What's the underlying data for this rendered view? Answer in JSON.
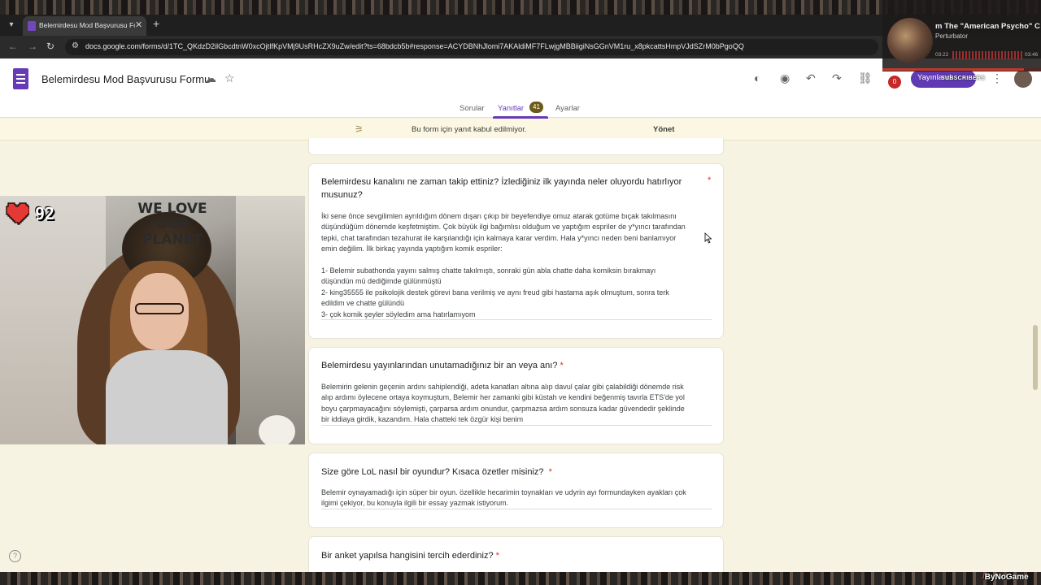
{
  "browser": {
    "tab_title": "Belemirdesu Mod Başvurusu Fo",
    "url": "docs.google.com/forms/d/1TC_QKdzD2ilGbcdtnW0xcOjtIfKpVMj9UsRHcZX9uZw/edit?ts=68bdcb5b#response=ACYDBNhJlomi7AKAldiMF7FLwjgMBBiigiNsGGnVM1ru_x8pkcattsHmpVJdSZrM0bPgoQQ"
  },
  "header": {
    "title": "Belemirdesu Mod Başvurusu Formu",
    "publish_label": "Yayınlandı",
    "notification_count": "0"
  },
  "tabs": {
    "questions": "Sorular",
    "responses": "Yanıtlar",
    "responses_count": "41",
    "settings": "Ayarlar"
  },
  "banner": {
    "text": "Bu form için yanıt kabul edilmiyor.",
    "action": "Yönet"
  },
  "questions": [
    {
      "title": "Belemirdesu kanalını ne zaman takip ettiniz? İzlediğiniz ilk yayında neler oluyordu hatırlıyor\nmusunuz?",
      "required_mark": "*",
      "answer": "İki sene önce sevgilimlen ayrıldığım dönem dışarı çıkıp bir beyefendiye omuz atarak gotüme bıçak takılmasını\ndüşündüğüm dönemde keşfetmiştim. Çok büyük ilgi bağımlısı olduğum ve yaptığım espriler de y*yıncı tarafından\ntepki, chat tarafından tezahurat ile karşılandığı için kalmaya karar verdim. Hala y*yıncı neden beni banlamıyor\nemin değilim. İlk birkaç yayında yaptığım komik espriler:\n\n1- Belemir subathonda yayını salmış chatte takılmıştı, sonraki gün abla chatte daha komiksin bırakmayı\ndüşündün mü dediğimde gülünmüştü\n2- king35555 ile psikolojik destek görevi bana verilmiş ve aynı freud gibi hastama aşık olmuştum, sonra terk\nedildim ve chatte gülündü\n3- çok komik şeyler söyledim ama hatırlamıyom"
    },
    {
      "title": "Belemirdesu yayınlarından unutamadığınız bir an veya anı?",
      "required_mark": "*",
      "answer": "Belemirin gelenin geçenin ardını sahiplendiği, adeta kanatları altına alıp davul çalar gibi çalabildiği dönemde risk\nalıp ardımı öylecene ortaya koymuştum, Belemir her zamanki gibi küstah ve kendini beğenmiş tavırla ETS'de yol\nboyu çarpmayacağını söylemişti, çarparsa ardım onundur, çarpmazsa ardım sonsuza kadar güvendedir şeklinde\nbir iddiaya girdik, kazandım. Hala chatteki tek özgür kişi benim"
    },
    {
      "title": "Size göre LoL nasıl bir oyundur? Kısaca özetler misiniz?",
      "required_mark": "*",
      "answer": "Belemir oynayamadığı için süper bir oyun. özellikle hecarimin toynakları ve udyrin ayı formundayken ayakları çok\nilgimi çekiyor, bu konuyla ilgili bir essay yazmak istiyorum."
    },
    {
      "title": "Bir anket yapılsa hangisini tercih ederdiniz?",
      "required_mark": "*"
    }
  ],
  "webcam": {
    "hp_value": "92",
    "shirt_text": "WE LOVE OUR PLANET"
  },
  "music": {
    "title": "m The \"American Psycho\" C",
    "artist": "Perturbator",
    "elapsed": "03:22",
    "total": "03:46",
    "progress_fraction": 0.89
  },
  "overlay": {
    "subscribers_label": "SUBSCRIBERS",
    "watermark": "ByNoGame",
    "watermark_mark": "/"
  },
  "colors": {
    "accent": "#673ab7",
    "required": "#d93025",
    "background": "#f6f3e3",
    "publish": "#5f3ab2"
  }
}
